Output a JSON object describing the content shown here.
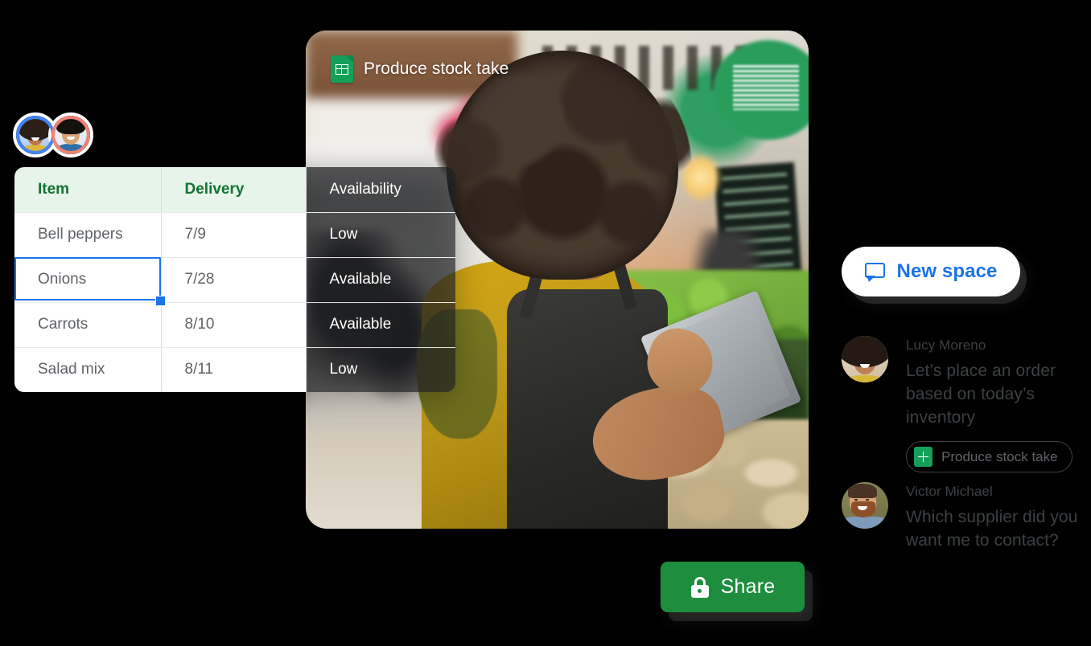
{
  "photo_card": {
    "title": "Produce stock take",
    "title_icon": "google-sheets-icon"
  },
  "spreadsheet": {
    "columns": [
      "Item",
      "Delivery",
      "Availability"
    ],
    "rows": [
      {
        "item": "Bell peppers",
        "delivery": "7/9",
        "availability": "Low"
      },
      {
        "item": "Onions",
        "delivery": "7/28",
        "availability": "Available"
      },
      {
        "item": "Carrots",
        "delivery": "8/10",
        "availability": "Available"
      },
      {
        "item": "Salad mix",
        "delivery": "8/11",
        "availability": "Low"
      }
    ],
    "selected_cell": "Onions",
    "header_text_color": "#137333",
    "header_bg_color": "#e6f4ea",
    "selection_color": "#1a73e8"
  },
  "avatars": {
    "pair": [
      {
        "name": "avatar-blue",
        "ring_color": "#4285f4"
      },
      {
        "name": "avatar-red",
        "ring_color": "#ef8374"
      }
    ]
  },
  "share_button": {
    "label": "Share",
    "icon": "lock-icon",
    "bg_color": "#1e8e3e",
    "text_color": "#ffffff"
  },
  "new_space_button": {
    "label": "New space",
    "icon": "chat-bubble-icon",
    "text_color": "#1a73e8",
    "bg_color": "#ffffff"
  },
  "chat": {
    "messages": [
      {
        "author": "Lucy Moreno",
        "text": "Let’s place an order based on today’s inventory",
        "attachment": {
          "label": "Produce stock take",
          "icon": "google-sheets-icon"
        }
      },
      {
        "author": "Victor Michael",
        "text": "Which supplier did you want me to contact?"
      }
    ]
  }
}
